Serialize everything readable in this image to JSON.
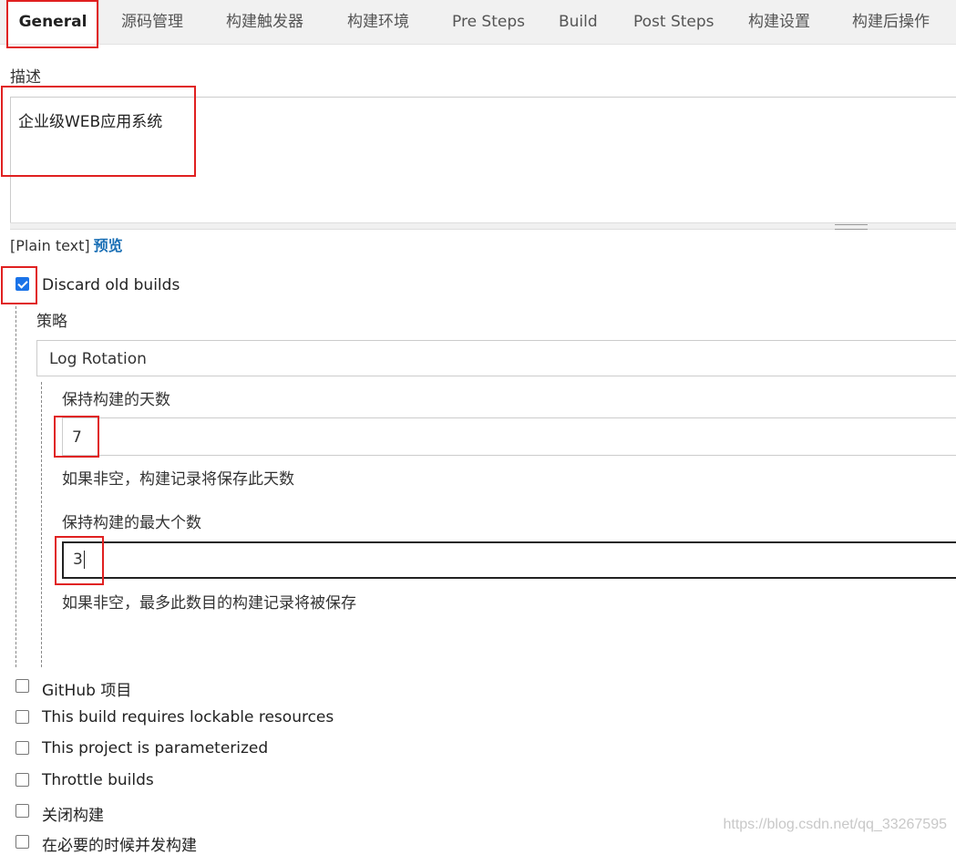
{
  "tabs": [
    {
      "label": "General",
      "active": true
    },
    {
      "label": "源码管理"
    },
    {
      "label": "构建触发器"
    },
    {
      "label": "构建环境"
    },
    {
      "label": "Pre Steps"
    },
    {
      "label": "Build"
    },
    {
      "label": "Post Steps"
    },
    {
      "label": "构建设置"
    },
    {
      "label": "构建后操作"
    }
  ],
  "description": {
    "label": "描述",
    "value": "企业级WEB应用系统",
    "format_text": "[Plain text]",
    "preview_link": "预览"
  },
  "discard_old_builds": {
    "label": "Discard old builds",
    "checked": true,
    "strategy_label": "策略",
    "strategy_value": "Log Rotation",
    "days_to_keep": {
      "label": "保持构建的天数",
      "value": "7",
      "hint": "如果非空，构建记录将保存此天数"
    },
    "max_builds": {
      "label": "保持构建的最大个数",
      "value": "3",
      "hint": "如果非空，最多此数目的构建记录将被保存"
    }
  },
  "options": [
    {
      "label": "GitHub 项目",
      "checked": false
    },
    {
      "label": "This build requires lockable resources",
      "checked": false
    },
    {
      "label": "This project is parameterized",
      "checked": false
    },
    {
      "label": "Throttle builds",
      "checked": false
    },
    {
      "label": "关闭构建",
      "checked": false
    },
    {
      "label": "在必要的时候并发构建",
      "checked": false
    }
  ],
  "watermark": "https://blog.csdn.net/qq_33267595",
  "colors": {
    "highlight": "#e02020",
    "link": "#1a6fb5",
    "checkbox_checked": "#1a73e8"
  }
}
